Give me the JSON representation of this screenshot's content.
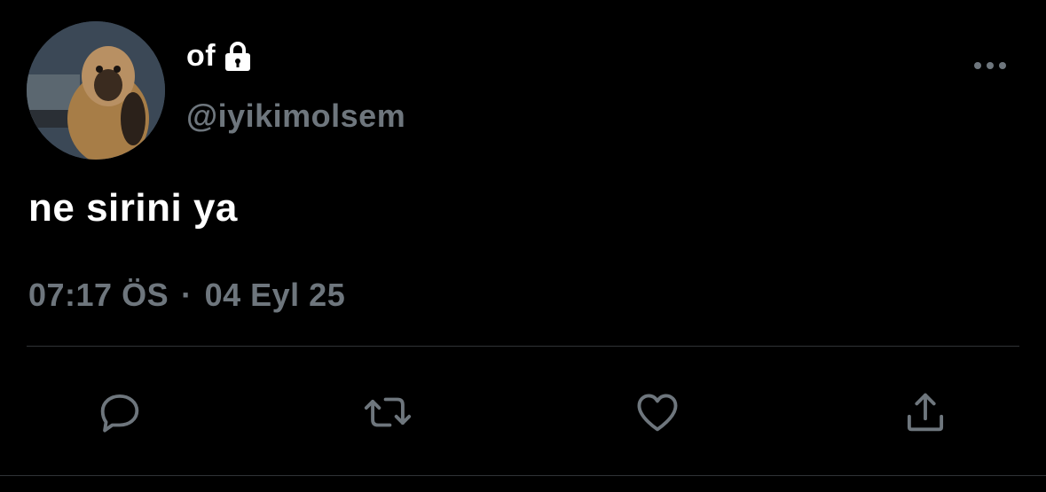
{
  "author": {
    "display_name": "of",
    "handle": "@iyikimolsem",
    "protected": true
  },
  "tweet": {
    "text": "ne sirini ya",
    "time": "07:17 ÖS",
    "separator": "·",
    "date": "04 Eyl 25"
  },
  "icons": {
    "more": "more-horizontal-icon",
    "lock": "lock-icon",
    "reply": "reply-bubble-icon",
    "retweet": "retweet-icon",
    "like": "heart-icon",
    "share": "share-upload-icon"
  },
  "colors": {
    "background": "#000000",
    "primary_text": "#ffffff",
    "secondary_text": "#6e767d",
    "divider": "#2f3336"
  }
}
